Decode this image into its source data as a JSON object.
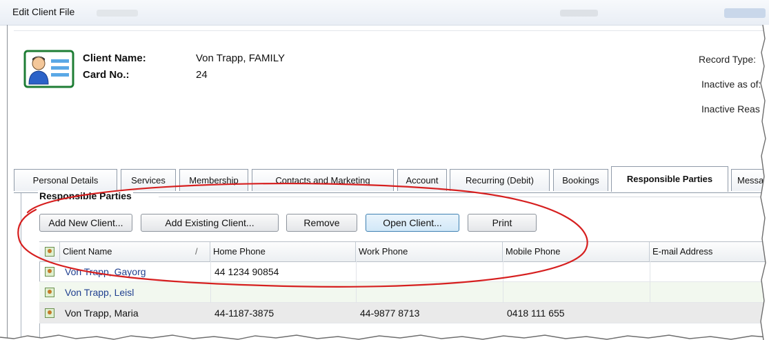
{
  "window": {
    "title": "Edit Client File"
  },
  "client": {
    "name_label": "Client Name:",
    "name_value": "Von Trapp, FAMILY",
    "card_label": "Card No.:",
    "card_value": "24"
  },
  "record_info": {
    "record_type": "Record Type:",
    "inactive_as_of": "Inactive as of:",
    "inactive_reason": "Inactive Reas"
  },
  "tabs": [
    {
      "label": "Personal Details"
    },
    {
      "label": "Services"
    },
    {
      "label": "Membership"
    },
    {
      "label": "Contacts and Marketing"
    },
    {
      "label": "Account"
    },
    {
      "label": "Recurring (Debit)"
    },
    {
      "label": "Bookings"
    },
    {
      "label": "Responsible Parties",
      "active": true
    },
    {
      "label": "Messag"
    }
  ],
  "group": {
    "title": "Responsible Parties"
  },
  "buttons": {
    "add_new": "Add New Client...",
    "add_existing": "Add Existing Client...",
    "remove": "Remove",
    "open": "Open Client...",
    "print": "Print"
  },
  "grid": {
    "columns": [
      "Client Name",
      "Home Phone",
      "Work Phone",
      "Mobile Phone",
      "E-mail Address"
    ],
    "sort_indicator": "/",
    "rows": [
      {
        "name": "Von Trapp, Gayorg",
        "home": "44 1234 90854",
        "work": "",
        "mobile": "",
        "email": ""
      },
      {
        "name": "Von Trapp, Leisl",
        "home": "",
        "work": "",
        "mobile": "",
        "email": ""
      },
      {
        "name": "Von Trapp, Maria",
        "home": "44-1187-3875",
        "work": "44-9877 8713",
        "mobile": "0418 111 655",
        "email": ""
      }
    ]
  },
  "colors": {
    "annotation": "#d61f1f",
    "link_text": "#1f3f8f",
    "focus_button": "#3c7fb1"
  }
}
